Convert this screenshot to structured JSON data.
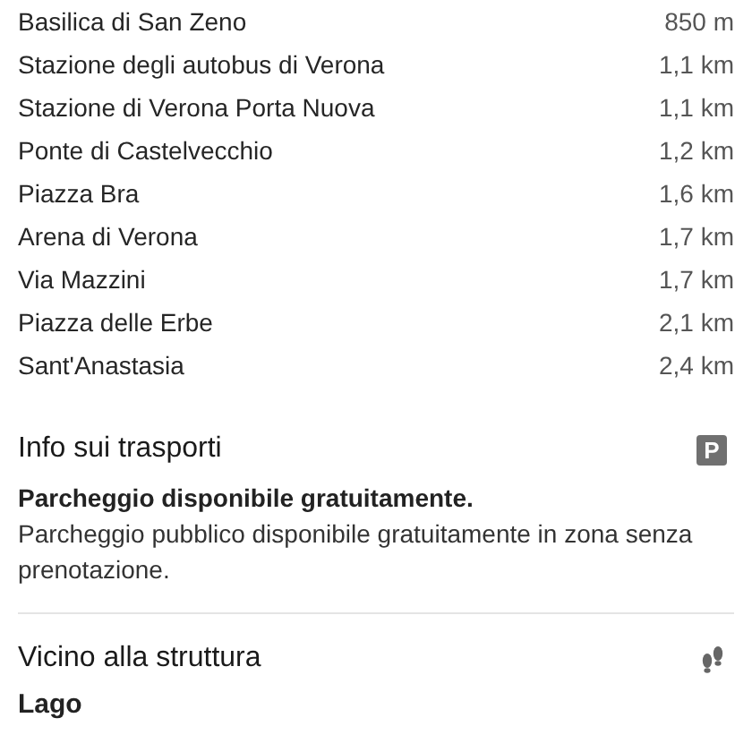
{
  "nearby_places": [
    {
      "name": "Basilica di San Zeno",
      "distance": "850 m"
    },
    {
      "name": "Stazione degli autobus di Verona",
      "distance": "1,1 km"
    },
    {
      "name": "Stazione di Verona Porta Nuova",
      "distance": "1,1 km"
    },
    {
      "name": "Ponte di Castelvecchio",
      "distance": "1,2 km"
    },
    {
      "name": "Piazza Bra",
      "distance": "1,6 km"
    },
    {
      "name": "Arena di Verona",
      "distance": "1,7 km"
    },
    {
      "name": "Via Mazzini",
      "distance": "1,7 km"
    },
    {
      "name": "Piazza delle Erbe",
      "distance": "2,1 km"
    },
    {
      "name": "Sant'Anastasia",
      "distance": "2,4 km"
    }
  ],
  "transport_info": {
    "title": "Info sui trasporti",
    "badge": "P",
    "headline": "Parcheggio disponibile gratuitamente.",
    "description": "Parcheggio pubblico disponibile gratuitamente in zona senza prenotazione."
  },
  "near_property": {
    "title": "Vicino alla struttura",
    "first_item": "Lago"
  }
}
